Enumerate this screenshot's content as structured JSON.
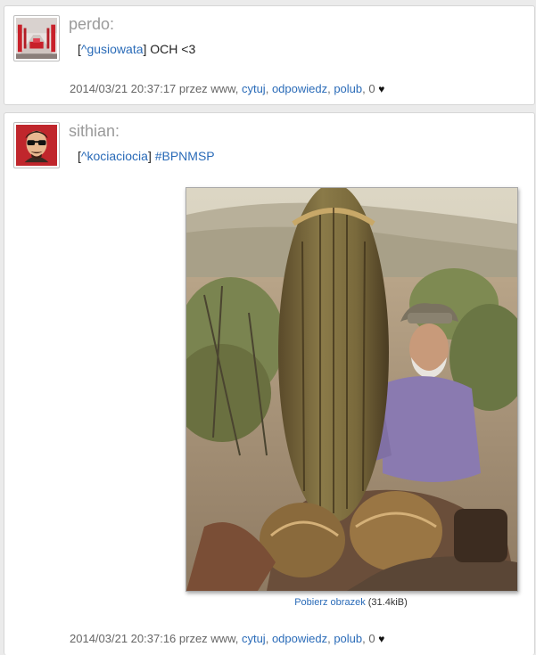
{
  "posts": [
    {
      "username": "perdo:",
      "reply_to": "^gusiowata",
      "message": " OCH <3",
      "timestamp": "2014/03/21 20:37:17",
      "via": " przez www, ",
      "actions": {
        "quote": "cytuj",
        "reply": "odpowiedz",
        "like": "polub"
      },
      "likes": "0"
    },
    {
      "username": "sithian:",
      "reply_to": "^kociaciocia",
      "hashtag": "#BPNMSP",
      "timestamp": "2014/03/21 20:37:16",
      "via": " przez www, ",
      "actions": {
        "quote": "cytuj",
        "reply": "odpowiedz",
        "like": "polub"
      },
      "likes": "0",
      "image": {
        "download_label": "Pobierz obrazek",
        "size": " (31.4kiB)"
      }
    }
  ],
  "colors": {
    "link": "#2a6bb8",
    "username": "#9a9a9a",
    "meta": "#666666"
  }
}
